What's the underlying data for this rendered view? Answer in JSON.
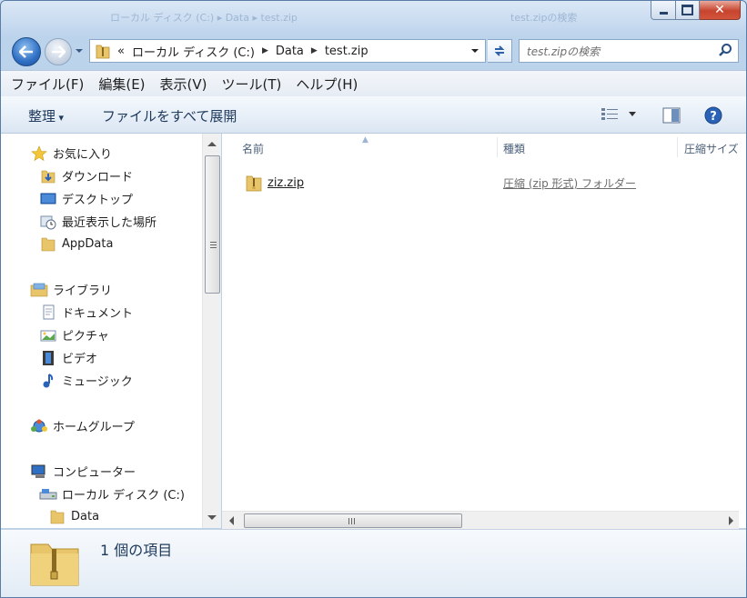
{
  "window": {
    "ghost_title_left": "ローカル ディスク (C:) ▸ Data ▸ test.zip",
    "ghost_title_right": "test.zipの検索"
  },
  "address_bar": {
    "overflow": "«",
    "crumbs": [
      "ローカル ディスク (C:)",
      "Data",
      "test.zip"
    ]
  },
  "search": {
    "placeholder": "test.zipの検索"
  },
  "menu": {
    "items": [
      "ファイル(F)",
      "編集(E)",
      "表示(V)",
      "ツール(T)",
      "ヘルプ(H)"
    ]
  },
  "toolbar": {
    "organize": "整理",
    "extract_all": "ファイルをすべて展開"
  },
  "nav_pane": {
    "favorites": {
      "label": "お気に入り",
      "items": [
        "ダウンロード",
        "デスクトップ",
        "最近表示した場所",
        "AppData"
      ]
    },
    "libraries": {
      "label": "ライブラリ",
      "items": [
        "ドキュメント",
        "ピクチャ",
        "ビデオ",
        "ミュージック"
      ]
    },
    "homegroup": {
      "label": "ホームグループ"
    },
    "computer": {
      "label": "コンピューター",
      "items": [
        "ローカル ディスク (C:)",
        "Data"
      ]
    }
  },
  "columns": {
    "name": "名前",
    "type": "種類",
    "size": "圧縮サイズ"
  },
  "files": [
    {
      "name": "ziz.zip",
      "type": "圧縮 (zip 形式) フォルダー"
    }
  ],
  "details": {
    "count_text": "1 個の項目"
  },
  "colors": {
    "accent": "#1e395b",
    "folder": "#e8c46a"
  }
}
